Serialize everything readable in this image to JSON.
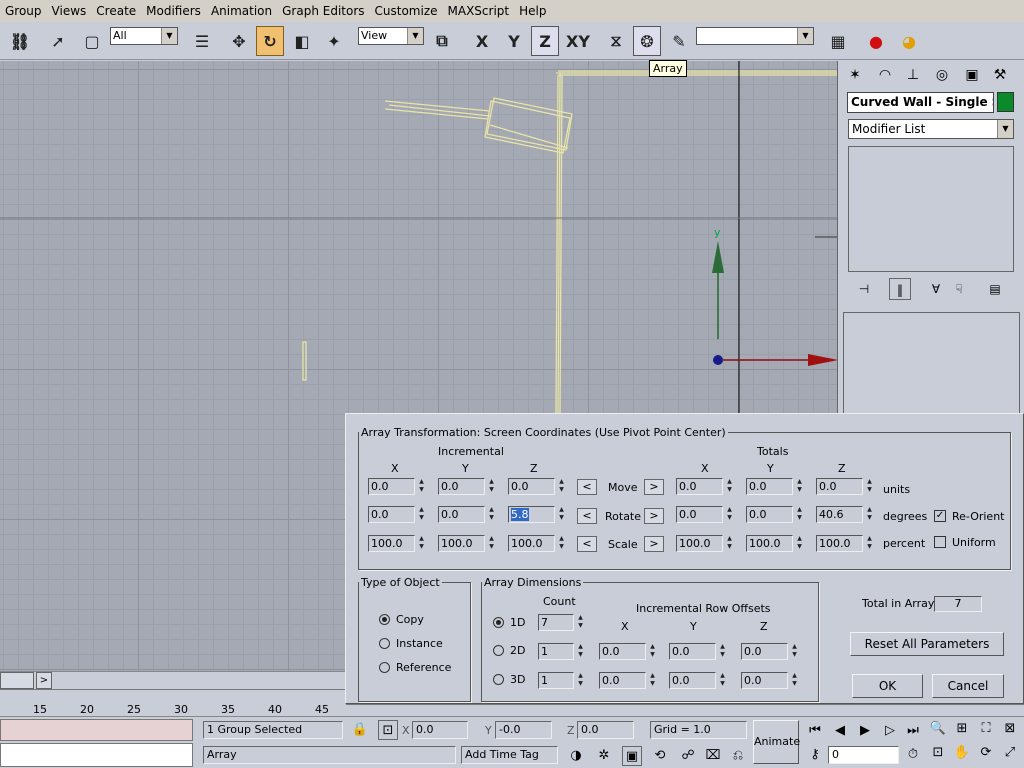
{
  "menu": [
    "Group",
    "Views",
    "Create",
    "Modifiers",
    "Animation",
    "Graph Editors",
    "Customize",
    "MAXScript",
    "Help"
  ],
  "toolbar": {
    "selection_filter": "All",
    "ref_coord": "View",
    "axis_x": "X",
    "axis_y": "Y",
    "axis_z": "Z",
    "axis_xy": "XY",
    "named_sets": ""
  },
  "tooltip": "Array",
  "viewport": {
    "gizmo_y": "y"
  },
  "command_panel": {
    "object_name": "Curved Wall - Single Sec",
    "object_color": "#0a8a2a",
    "modifier_list": "Modifier List"
  },
  "dialog": {
    "transform_legend": "Array Transformation: Screen Coordinates (Use Pivot Point Center)",
    "incremental": "Incremental",
    "totals": "Totals",
    "x": "X",
    "y": "Y",
    "z": "Z",
    "move": "Move",
    "rotate": "Rotate",
    "scale": "Scale",
    "units": "units",
    "degrees": "degrees",
    "percent": "percent",
    "reorient": "Re-Orient",
    "uniform": "Uniform",
    "reorient_checked": true,
    "uniform_checked": false,
    "inc_move": [
      "0.0",
      "0.0",
      "0.0"
    ],
    "inc_rotate": [
      "0.0",
      "0.0",
      "5.8"
    ],
    "inc_scale": [
      "100.0",
      "100.0",
      "100.0"
    ],
    "tot_move": [
      "0.0",
      "0.0",
      "0.0"
    ],
    "tot_rotate": [
      "0.0",
      "0.0",
      "40.6"
    ],
    "tot_scale": [
      "100.0",
      "100.0",
      "100.0"
    ],
    "type_legend": "Type of Object",
    "copy": "Copy",
    "instance": "Instance",
    "reference": "Reference",
    "dims_legend": "Array Dimensions",
    "count": "Count",
    "row_offsets": "Incremental Row Offsets",
    "d1": "1D",
    "d2": "2D",
    "d3": "3D",
    "count_1d": "7",
    "count_2d": "1",
    "count_3d": "1",
    "off_2d": [
      "0.0",
      "0.0",
      "0.0"
    ],
    "off_3d": [
      "0.0",
      "0.0",
      "0.0"
    ],
    "total_label": "Total in Array:",
    "total_value": "7",
    "reset": "Reset All Parameters",
    "ok": "OK",
    "cancel": "Cancel"
  },
  "timeline": {
    "ticks": [
      "15",
      "20",
      "25",
      "30",
      "35",
      "40",
      "45"
    ]
  },
  "statusbar": {
    "selected": "1 Group Selected",
    "prompt": "Array",
    "x_label": "X",
    "y_label": "Y",
    "z_label": "Z",
    "x": "0.0",
    "y": "-0.0",
    "z": "0.0",
    "grid": "Grid = 1.0",
    "add_time_tag": "Add Time Tag",
    "animate": "Animate",
    "frame": "0"
  }
}
